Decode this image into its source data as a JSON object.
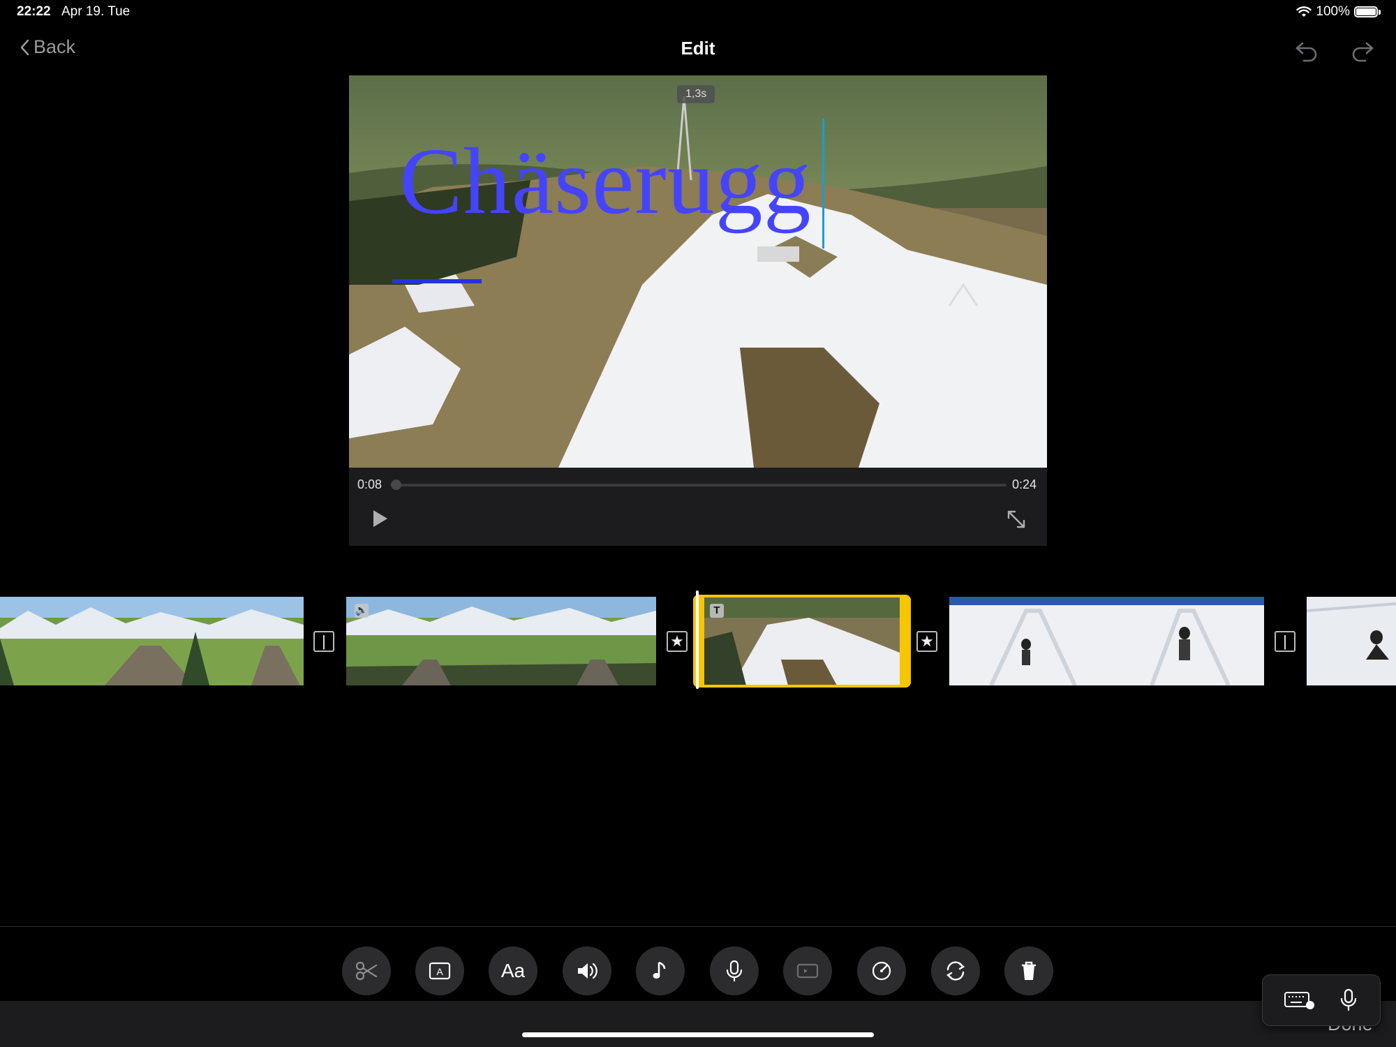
{
  "status_bar": {
    "time": "22:22",
    "date": "Apr 19. Tue",
    "battery": "100%"
  },
  "nav": {
    "back_label": "Back",
    "title": "Edit"
  },
  "viewer": {
    "title_text": "Chäserugg",
    "duration_badge": "1,3s",
    "current_time": "0:08",
    "total_time": "0:24",
    "progress": 0.0
  },
  "timeline": {
    "transition_icons": [
      "|",
      "★",
      "★",
      "|"
    ],
    "selected_clip_index": 2
  },
  "toolbar": {
    "tools": [
      "scissors-icon",
      "title-icon",
      "text-style-icon",
      "volume-icon",
      "music-note-icon",
      "microphone-icon",
      "camera-icon",
      "speed-icon",
      "rotate-icon",
      "trash-icon"
    ],
    "text_style_label": "Aa",
    "done_label": "Done"
  },
  "colors": {
    "accent": "#f7c600",
    "title_blue": "#4444ff",
    "background": "#000000"
  }
}
